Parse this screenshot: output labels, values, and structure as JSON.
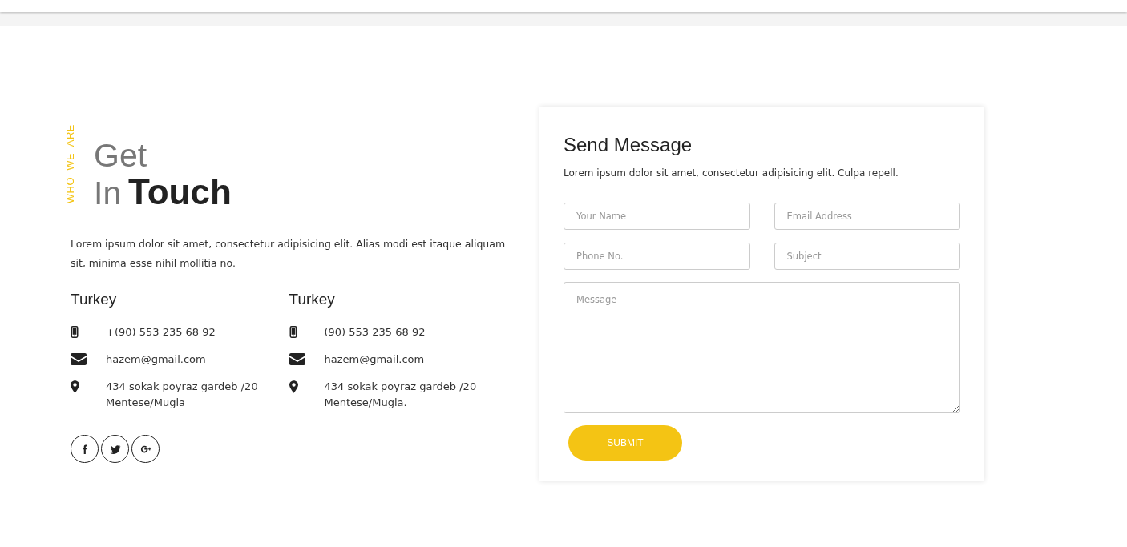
{
  "side_label": "WHO  WE  ARE",
  "heading": {
    "light_top": "Get",
    "light_bottom": "In",
    "bold": "Touch"
  },
  "intro": "Lorem ipsum dolor sit amet, consectetur adipisicing elit. Alias modi est itaque aliquam sit, minima esse nihil mollitia no.",
  "offices": [
    {
      "country": "Turkey",
      "contacts": [
        {
          "kind": "phone",
          "text": "+(90) 553 235 68 92"
        },
        {
          "kind": "email",
          "text": "hazem@gmail.com"
        },
        {
          "kind": "address",
          "text": "434 sokak poyraz gardeb /20 Mentese/Mugla"
        }
      ]
    },
    {
      "country": "Turkey",
      "contacts": [
        {
          "kind": "phone",
          "text": "(90) 553 235 68 92"
        },
        {
          "kind": "email",
          "text": "hazem@gmail.com"
        },
        {
          "kind": "address",
          "text": "434 sokak poyraz gardeb /20 Mentese/Mugla."
        }
      ]
    }
  ],
  "social": [
    {
      "kind": "facebook"
    },
    {
      "kind": "twitter"
    },
    {
      "kind": "google-plus"
    }
  ],
  "form": {
    "title": "Send Message",
    "description": "Lorem ipsum dolor sit amet, consectetur adipisicing elit. Culpa repell.",
    "fields": [
      {
        "placeholder": "Your Name"
      },
      {
        "placeholder": "Email Address"
      },
      {
        "placeholder": "Phone No."
      },
      {
        "placeholder": "Subject"
      }
    ],
    "message": {
      "placeholder": "Message"
    },
    "submit": "SUBMIT"
  }
}
